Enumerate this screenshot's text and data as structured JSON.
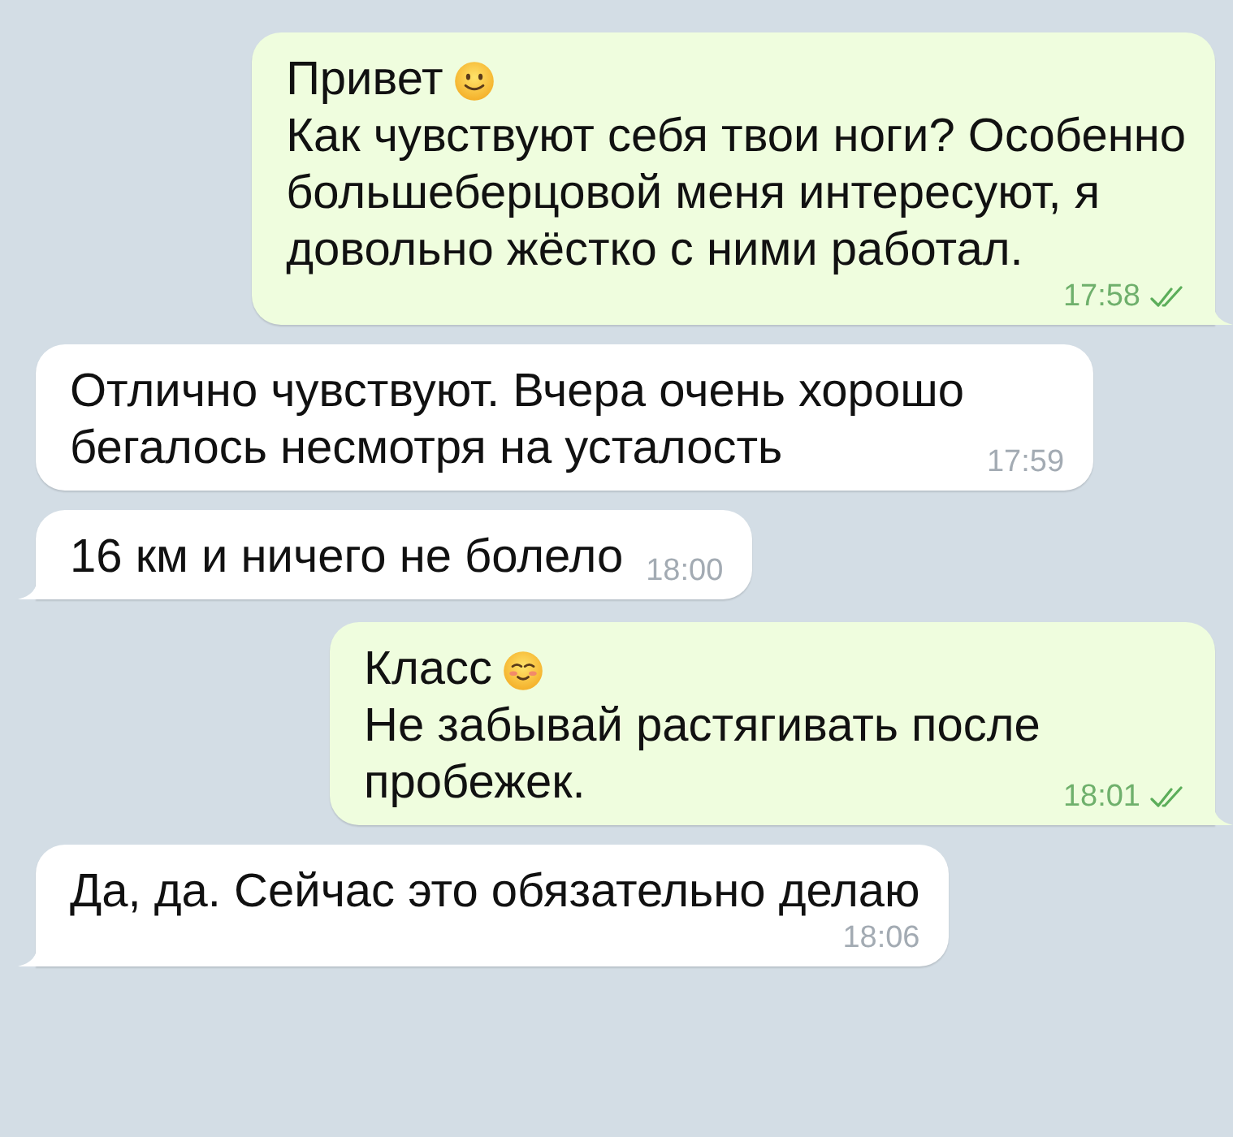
{
  "messages": [
    {
      "outgoing": true,
      "tail": true,
      "title": "Привет",
      "emoji": {
        "kind": "smile"
      },
      "text": "Как чувствуют себя твои ноги? Особенно\nбольшеберцовой меня интересуют, я\nдовольно жёстко с ними работал.",
      "time": "17:58",
      "read": true,
      "meta_below": true
    },
    {
      "outgoing": false,
      "tail": false,
      "text": "Отлично чувствуют. Вчера очень хорошо\nбегалось несмотря на усталость",
      "time": "17:59"
    },
    {
      "outgoing": false,
      "tail": true,
      "text": "16 км и ничего не болело",
      "time": "18:00"
    },
    {
      "outgoing": true,
      "tail": true,
      "title": "Класс",
      "emoji": {
        "kind": "blush"
      },
      "text": "Не забывай растягивать после\nпробежек.",
      "time": "18:01",
      "read": true
    },
    {
      "outgoing": false,
      "tail": true,
      "text": "Да, да. Сейчас это обязательно делаю",
      "time": "18:06",
      "meta_below": true
    }
  ]
}
